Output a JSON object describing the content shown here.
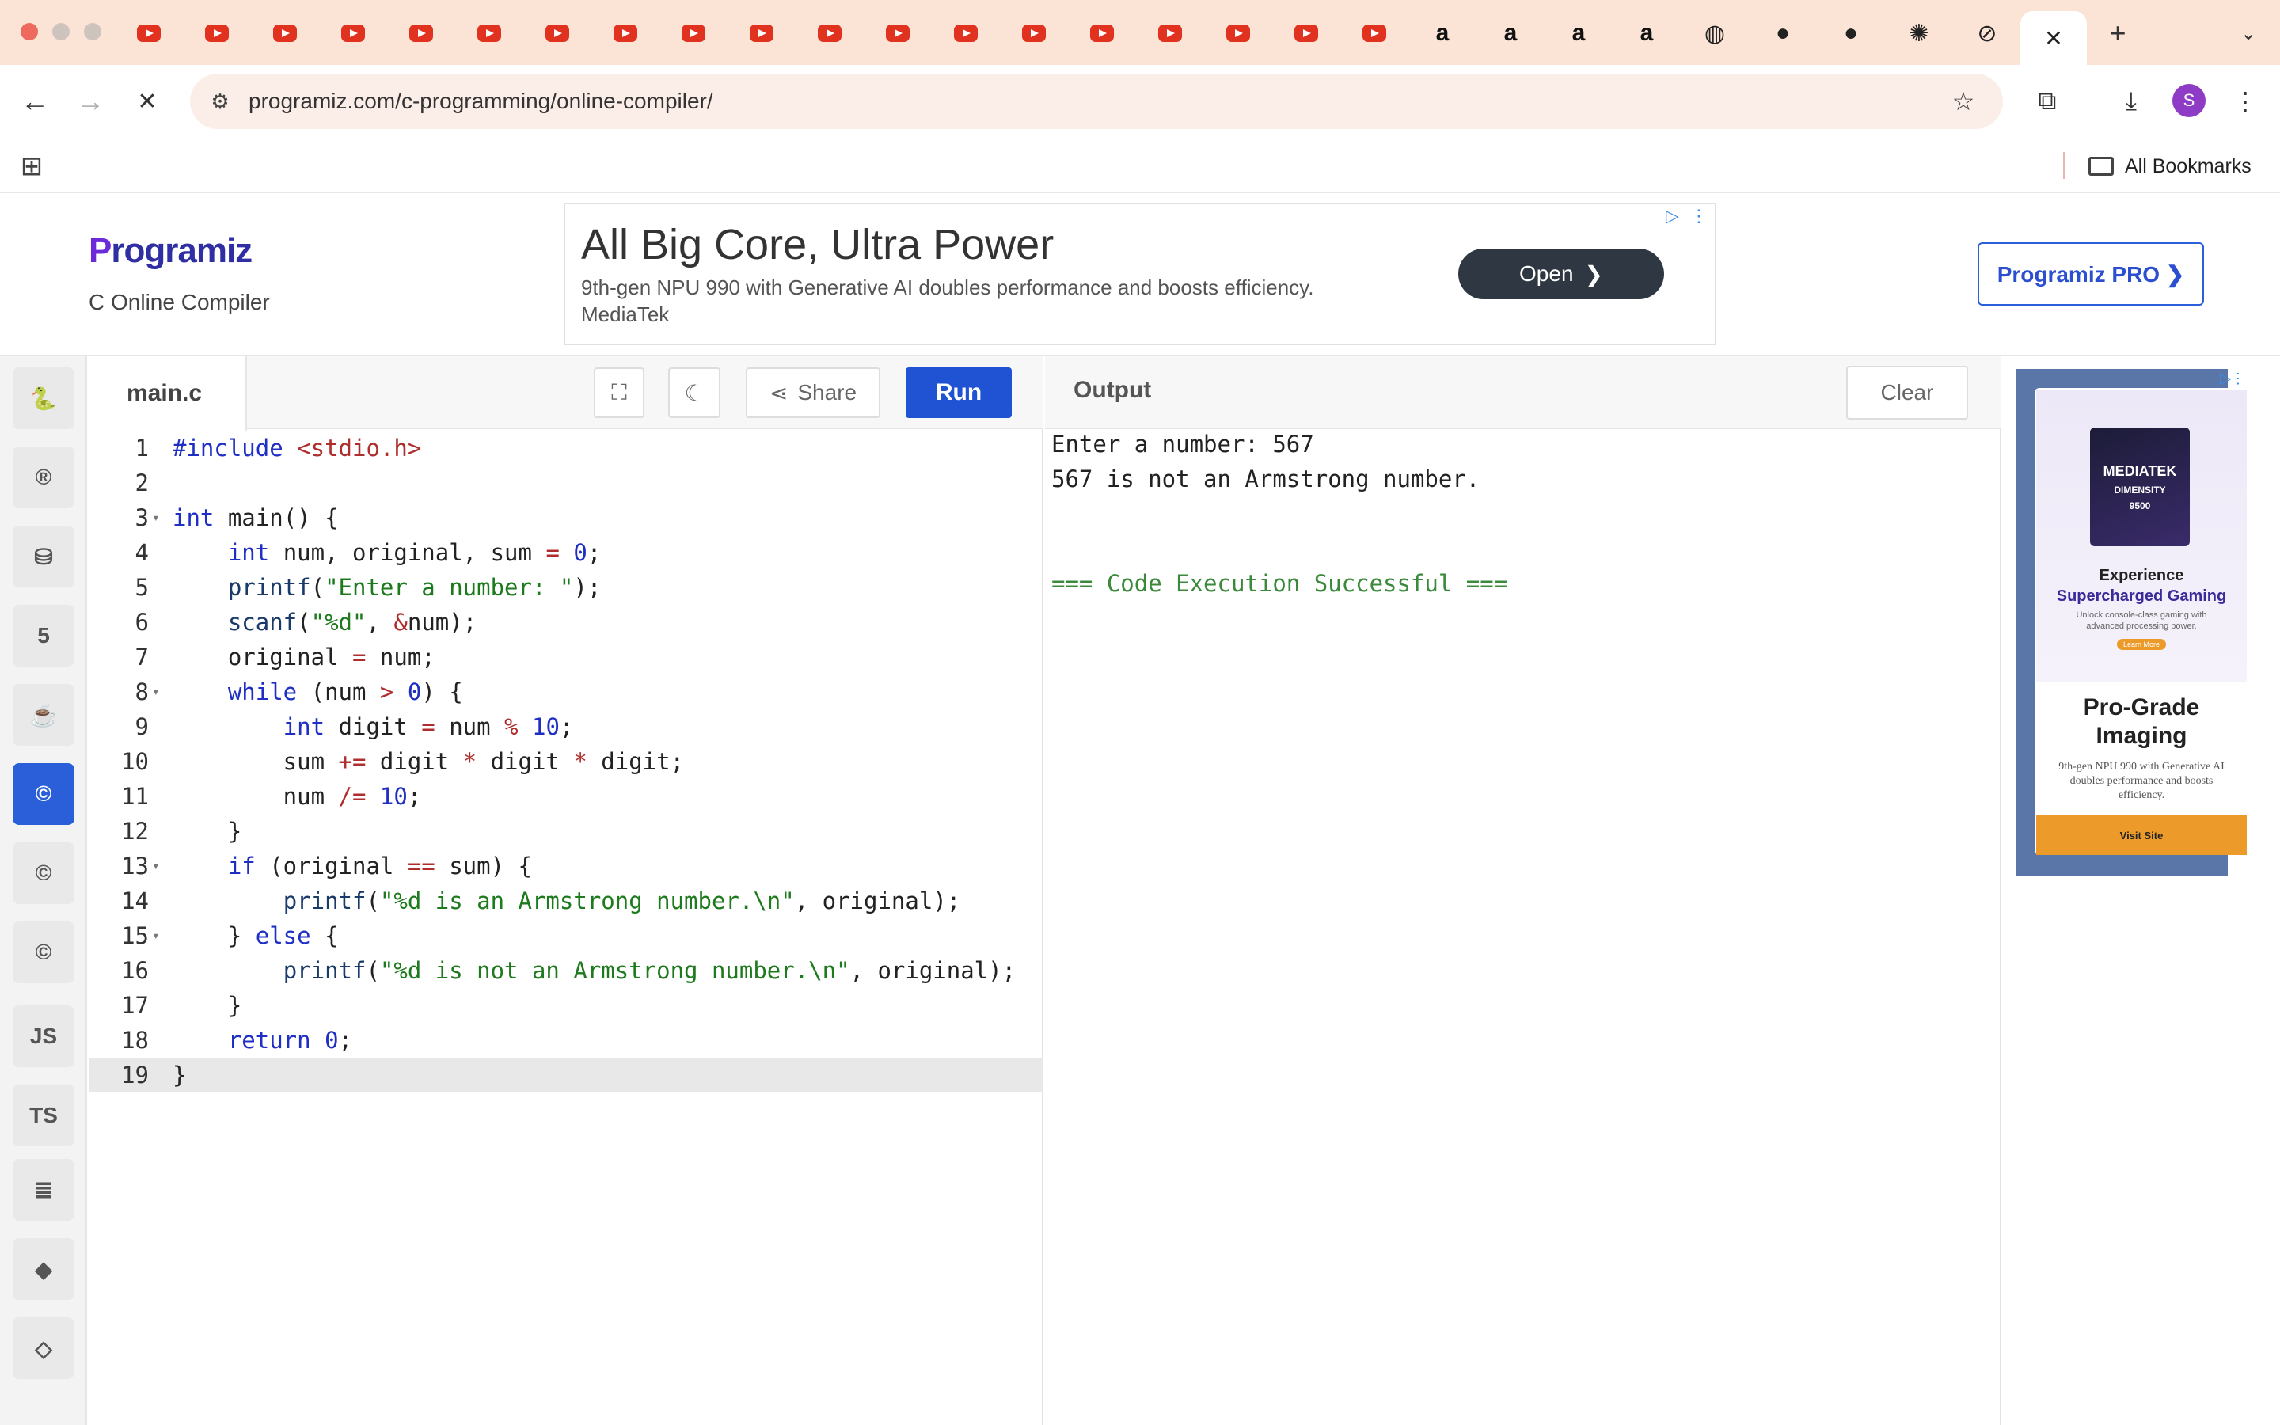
{
  "browser": {
    "url": "programiz.com/c-programming/online-compiler/",
    "bookmarks_label": "All Bookmarks",
    "profile_initial": "S",
    "new_tab": "+",
    "close_tab": "✕",
    "amazon_glyph": "a"
  },
  "site": {
    "logo_first": "P",
    "logo_rest": "rogramiz",
    "subtitle": "C Online Compiler",
    "pro_button": "Programiz PRO ❯"
  },
  "ad": {
    "headline": "All Big Core, Ultra Power",
    "description": "9th-gen NPU 990 with Generative AI doubles performance and boosts efficiency.",
    "advertiser": "MediaTek",
    "cta": "Open"
  },
  "sidebar": {
    "languages": [
      "python",
      "r",
      "sql",
      "html",
      "java",
      "c",
      "cpp",
      "csharp",
      "js",
      "ts",
      "go",
      "swift",
      "kotlin"
    ],
    "js_label": "JS",
    "ts_label": "TS"
  },
  "editor": {
    "filename": "main.c",
    "share_label": "Share",
    "run_label": "Run",
    "line_numbers": [
      "1",
      "2",
      "3",
      "4",
      "5",
      "6",
      "7",
      "8",
      "9",
      "10",
      "11",
      "12",
      "13",
      "14",
      "15",
      "16",
      "17",
      "18",
      "19"
    ]
  },
  "output": {
    "title": "Output",
    "clear_label": "Clear",
    "lines": [
      "Enter a number: 567",
      "567 is not an Armstrong number.",
      "",
      "",
      "=== Code Execution Successful ==="
    ]
  },
  "right_ad": {
    "chip_brand": "MEDIATEK",
    "chip_model": "DIMENSITY",
    "chip_number": "9500",
    "tagline1": "Experience",
    "tagline2": "Supercharged Gaming",
    "small": "Unlock console-class gaming with advanced processing power.",
    "learn_more": "Learn More",
    "headline": "Pro-Grade Imaging",
    "desc": "9th-gen NPU 990 with Generative AI doubles performance and boosts efficiency.",
    "cta": "Visit Site"
  }
}
